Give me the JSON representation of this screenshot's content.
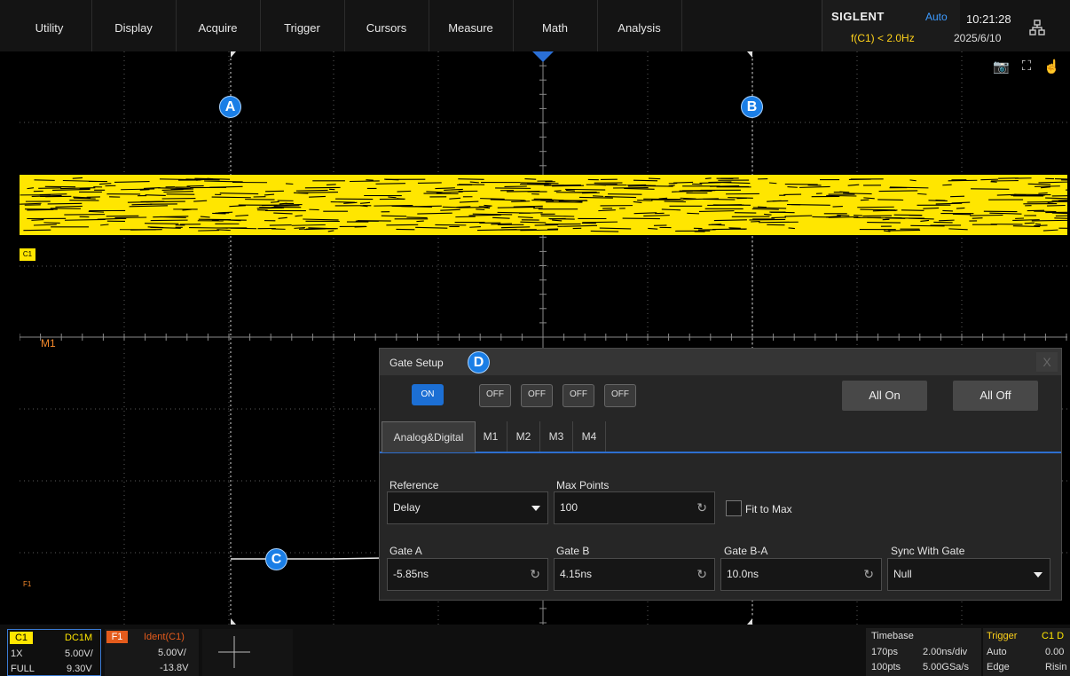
{
  "menu": [
    "Utility",
    "Display",
    "Acquire",
    "Trigger",
    "Cursors",
    "Measure",
    "Math",
    "Analysis"
  ],
  "status": {
    "brand": "SIGLENT",
    "trigger_mode": "Auto",
    "frequency": "f(C1) < 2.0Hz",
    "time": "10:21:28",
    "date": "2025/6/10"
  },
  "screen_icons": {
    "camera": "camera-icon",
    "fullscreen": "fullscreen-icon",
    "touch": "touch-icon"
  },
  "waveform": {
    "c1_marker": "C1",
    "m1_label": "M1",
    "f1_marker": "F1",
    "trace_color": "#ffe600",
    "math_color": "#f3882a"
  },
  "callouts": {
    "a": "A",
    "b": "B",
    "c": "C",
    "d": "D"
  },
  "gate_setup": {
    "title": "Gate Setup",
    "close": "X",
    "toggles": [
      "ON",
      "OFF",
      "OFF",
      "OFF",
      "OFF"
    ],
    "all_on": "All On",
    "all_off": "All Off",
    "tabs": [
      "Analog&Digital",
      "M1",
      "M2",
      "M3",
      "M4"
    ],
    "reference_label": "Reference",
    "reference_value": "Delay",
    "max_points_label": "Max Points",
    "max_points_value": "100",
    "fit_to_max_label": "Fit to Max",
    "gate_a_label": "Gate A",
    "gate_a_value": "-5.85ns",
    "gate_b_label": "Gate B",
    "gate_b_value": "4.15ns",
    "gate_ba_label": "Gate B-A",
    "gate_ba_value": "10.0ns",
    "sync_label": "Sync With Gate",
    "sync_value": "Null"
  },
  "channel_c1": {
    "tag": "C1",
    "coupling": "DC1M",
    "probe": "1X",
    "scale": "5.00V/",
    "bw": "FULL",
    "offset": "9.30V"
  },
  "channel_f1": {
    "tag": "F1",
    "function": "Ident(C1)",
    "scale": "5.00V/",
    "offset": "-13.8V"
  },
  "timebase": {
    "title": "Timebase",
    "delay": "170ps",
    "scale": "2.00ns/div",
    "points": "100pts",
    "rate": "5.00GSa/s"
  },
  "trigger": {
    "title": "Trigger",
    "source": "C1 D",
    "mode": "Auto",
    "level": "0.00",
    "type": "Edge",
    "slope": "Risin"
  }
}
